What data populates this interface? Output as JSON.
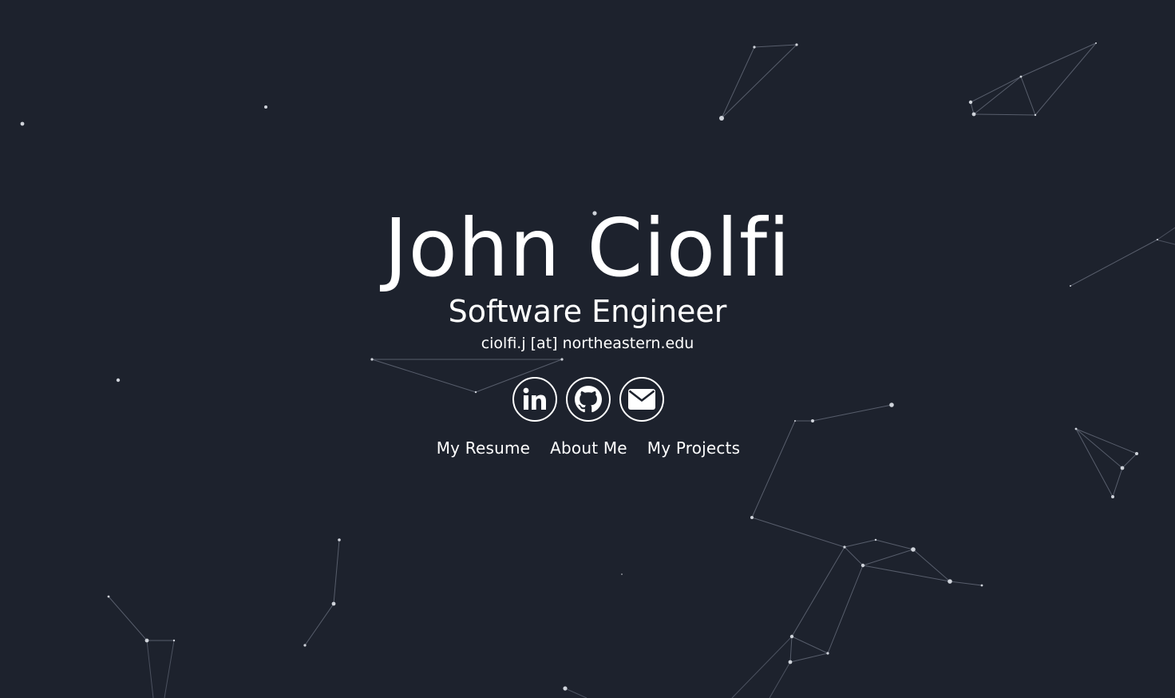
{
  "hero": {
    "name": "John Ciolfi",
    "title": "Software Engineer",
    "email": "ciolfi.j [at] northeastern.edu"
  },
  "social_links": [
    {
      "icon": "linkedin-icon"
    },
    {
      "icon": "github-icon"
    },
    {
      "icon": "email-icon"
    }
  ],
  "nav": {
    "resume_label": "My Resume",
    "about_label": "About Me",
    "projects_label": "My Projects"
  },
  "colors": {
    "background": "#1d222d",
    "text": "#ffffff",
    "particle": "#cfd3da",
    "particle_link": "#6b7180"
  }
}
